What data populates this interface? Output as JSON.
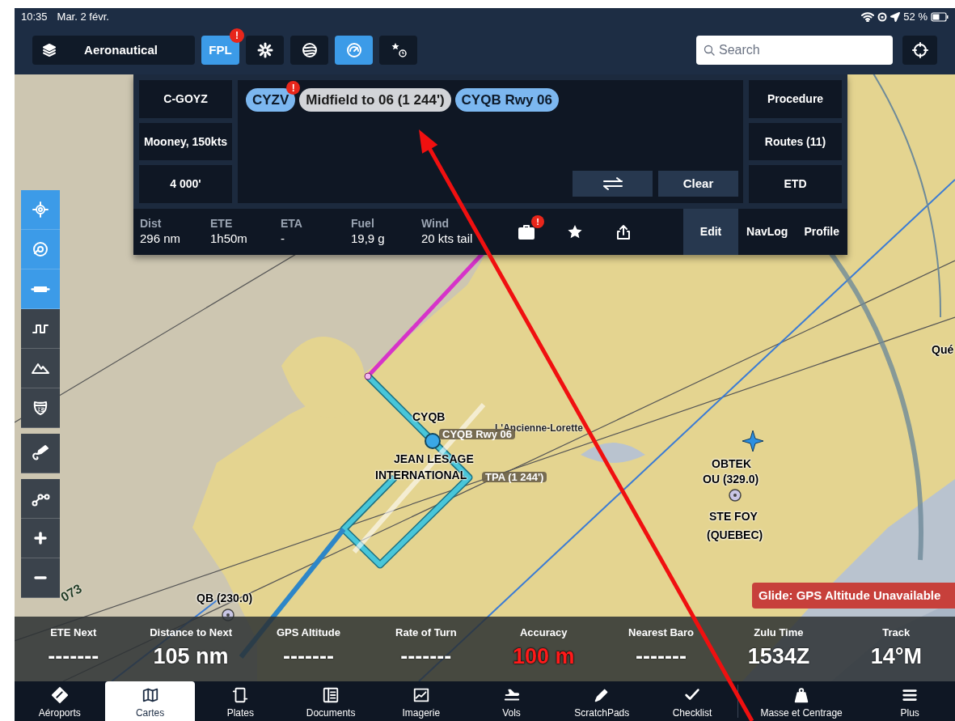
{
  "status_bar": {
    "time": "10:35",
    "date": "Mar. 2 févr.",
    "battery": "52 %"
  },
  "toolbar": {
    "layers": "Aeronautical",
    "buttons": [
      {
        "kind": "text",
        "label": "FPL",
        "selected": true,
        "badge": "!"
      },
      {
        "kind": "gear",
        "selected": false
      },
      {
        "kind": "globe",
        "selected": false
      },
      {
        "kind": "gauge",
        "selected": true
      },
      {
        "kind": "starclock",
        "selected": false
      }
    ],
    "search": {
      "placeholder": "Search"
    }
  },
  "flight_plan": {
    "aircraft": [
      "C-GOYZ",
      "Mooney, 150kts",
      "4 000'"
    ],
    "route": [
      {
        "label": "CYZV",
        "kind": "airport",
        "badge": "!"
      },
      {
        "label": "Midfield to 06 (1 244')",
        "kind": "procedure"
      },
      {
        "label": "CYQB Rwy 06",
        "kind": "airport"
      }
    ],
    "clear": "Clear",
    "options": [
      "Procedure",
      "Routes (11)",
      "ETD"
    ],
    "stats": [
      {
        "label": "Dist",
        "value": "296 nm"
      },
      {
        "label": "ETE",
        "value": "1h50m"
      },
      {
        "label": "ETA",
        "value": "-"
      },
      {
        "label": "Fuel",
        "value": "19,9 g"
      },
      {
        "label": "Wind",
        "value": "20 kts tail"
      }
    ],
    "bag_badge": "!",
    "tabs": [
      {
        "label": "Edit",
        "selected": true
      },
      {
        "label": "NavLog",
        "selected": false
      },
      {
        "label": "Profile",
        "selected": false
      }
    ]
  },
  "map_tools": [
    {
      "selected": true
    },
    {
      "selected": true
    },
    {
      "selected": true
    },
    {
      "selected": false
    },
    {
      "selected": false
    },
    {
      "selected": false
    },
    {
      "selected": false
    },
    {
      "selected": false
    },
    {
      "selected": false
    },
    {
      "selected": false
    }
  ],
  "map_labels": [
    {
      "kind": "place",
      "text": "CYQB"
    },
    {
      "kind": "town",
      "text": "L'Ancienne-Lorette"
    },
    {
      "kind": "tag",
      "text": "CYQB Rwy 06"
    },
    {
      "kind": "place",
      "text": "JEAN LESAGE"
    },
    {
      "kind": "place",
      "text": "INTERNATIONAL"
    },
    {
      "kind": "tag",
      "text": "TPA (1 244')"
    },
    {
      "kind": "place",
      "text": "OBTEK"
    },
    {
      "kind": "place",
      "text": "OU (329.0)"
    },
    {
      "kind": "place",
      "text": "STE FOY"
    },
    {
      "kind": "place",
      "text": "(QUEBEC)"
    },
    {
      "kind": "place",
      "text": "QB (230.0)"
    },
    {
      "kind": "place",
      "text": "Qué"
    },
    {
      "kind": "radial",
      "text": "073"
    }
  ],
  "glide_alert": "Glide: GPS Altitude Unavailable",
  "instruments": [
    {
      "label": "ETE Next",
      "value": "-------",
      "alert": false
    },
    {
      "label": "Distance to Next",
      "value": "105 nm",
      "alert": false
    },
    {
      "label": "GPS Altitude",
      "value": "-------",
      "alert": false
    },
    {
      "label": "Rate of Turn",
      "value": "-------",
      "alert": false
    },
    {
      "label": "Accuracy",
      "value": "100 m",
      "alert": true
    },
    {
      "label": "Nearest Baro",
      "value": "-------",
      "alert": false
    },
    {
      "label": "Zulu Time",
      "value": "1534Z",
      "alert": false
    },
    {
      "label": "Track",
      "value": "14°M",
      "alert": false
    }
  ],
  "tab_bar": [
    {
      "label": "Aéroports",
      "selected": false
    },
    {
      "label": "Cartes",
      "selected": true
    },
    {
      "label": "Plates",
      "selected": false
    },
    {
      "label": "Documents",
      "selected": false
    },
    {
      "label": "Imagerie",
      "selected": false
    },
    {
      "label": "Vols",
      "selected": false
    },
    {
      "label": "ScratchPads",
      "selected": false
    },
    {
      "label": "Checklist",
      "selected": false
    },
    {
      "label": "Masse et Centrage",
      "selected": false
    },
    {
      "label": "Plus",
      "selected": false
    }
  ]
}
